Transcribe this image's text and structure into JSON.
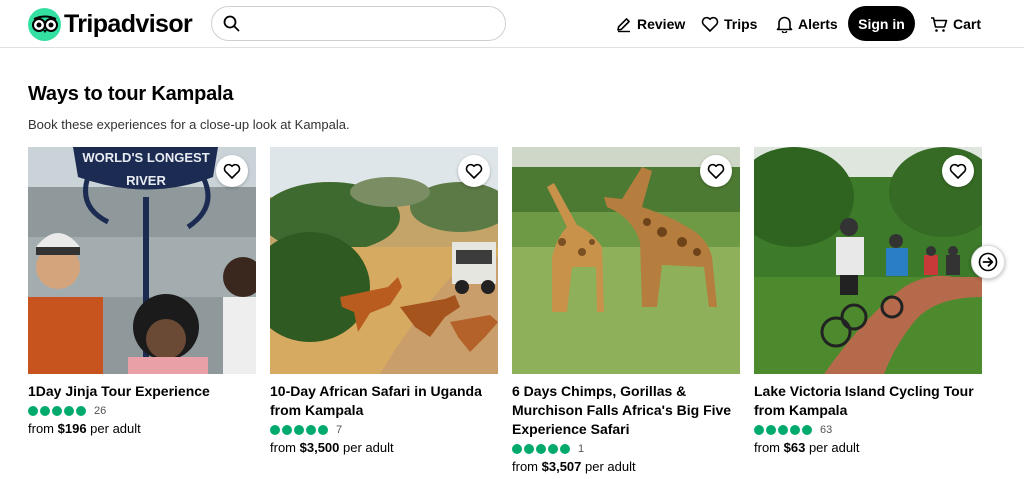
{
  "header": {
    "brand": "Tripadvisor",
    "search_placeholder": "",
    "nav": {
      "review": "Review",
      "trips": "Trips",
      "alerts": "Alerts",
      "signin": "Sign in",
      "cart": "Cart"
    }
  },
  "section": {
    "title": "Ways to tour Kampala",
    "subtitle": "Book these experiences for a close-up look at Kampala."
  },
  "cards": [
    {
      "title": "1Day Jinja Tour Experience",
      "rating": 5,
      "reviews": "26",
      "price_prefix": "from",
      "price": "$196",
      "price_suffix": "per adult",
      "sign_text_1": "WORLD'S LONGEST",
      "sign_text_2": "RIVER"
    },
    {
      "title": "10-Day African Safari in Uganda from Kampala",
      "rating": 5,
      "reviews": "7",
      "price_prefix": "from",
      "price": "$3,500",
      "price_suffix": "per adult"
    },
    {
      "title": "6 Days Chimps, Gorillas & Murchison Falls Africa's Big Five Experience Safari",
      "rating": 5,
      "reviews": "1",
      "price_prefix": "from",
      "price": "$3,507",
      "price_suffix": "per adult"
    },
    {
      "title": "Lake Victoria Island Cycling Tour from Kampala",
      "rating": 5,
      "reviews": "63",
      "price_prefix": "from",
      "price": "$63",
      "price_suffix": "per adult"
    }
  ],
  "colors": {
    "brand_green": "#34e0a1",
    "rating_green": "#00aa6c",
    "signin_bg": "#000000"
  },
  "icons": [
    "tripadvisor-owl-icon",
    "search-icon",
    "pencil-icon",
    "heart-icon",
    "bell-icon",
    "cart-icon",
    "arrow-right-icon"
  ]
}
